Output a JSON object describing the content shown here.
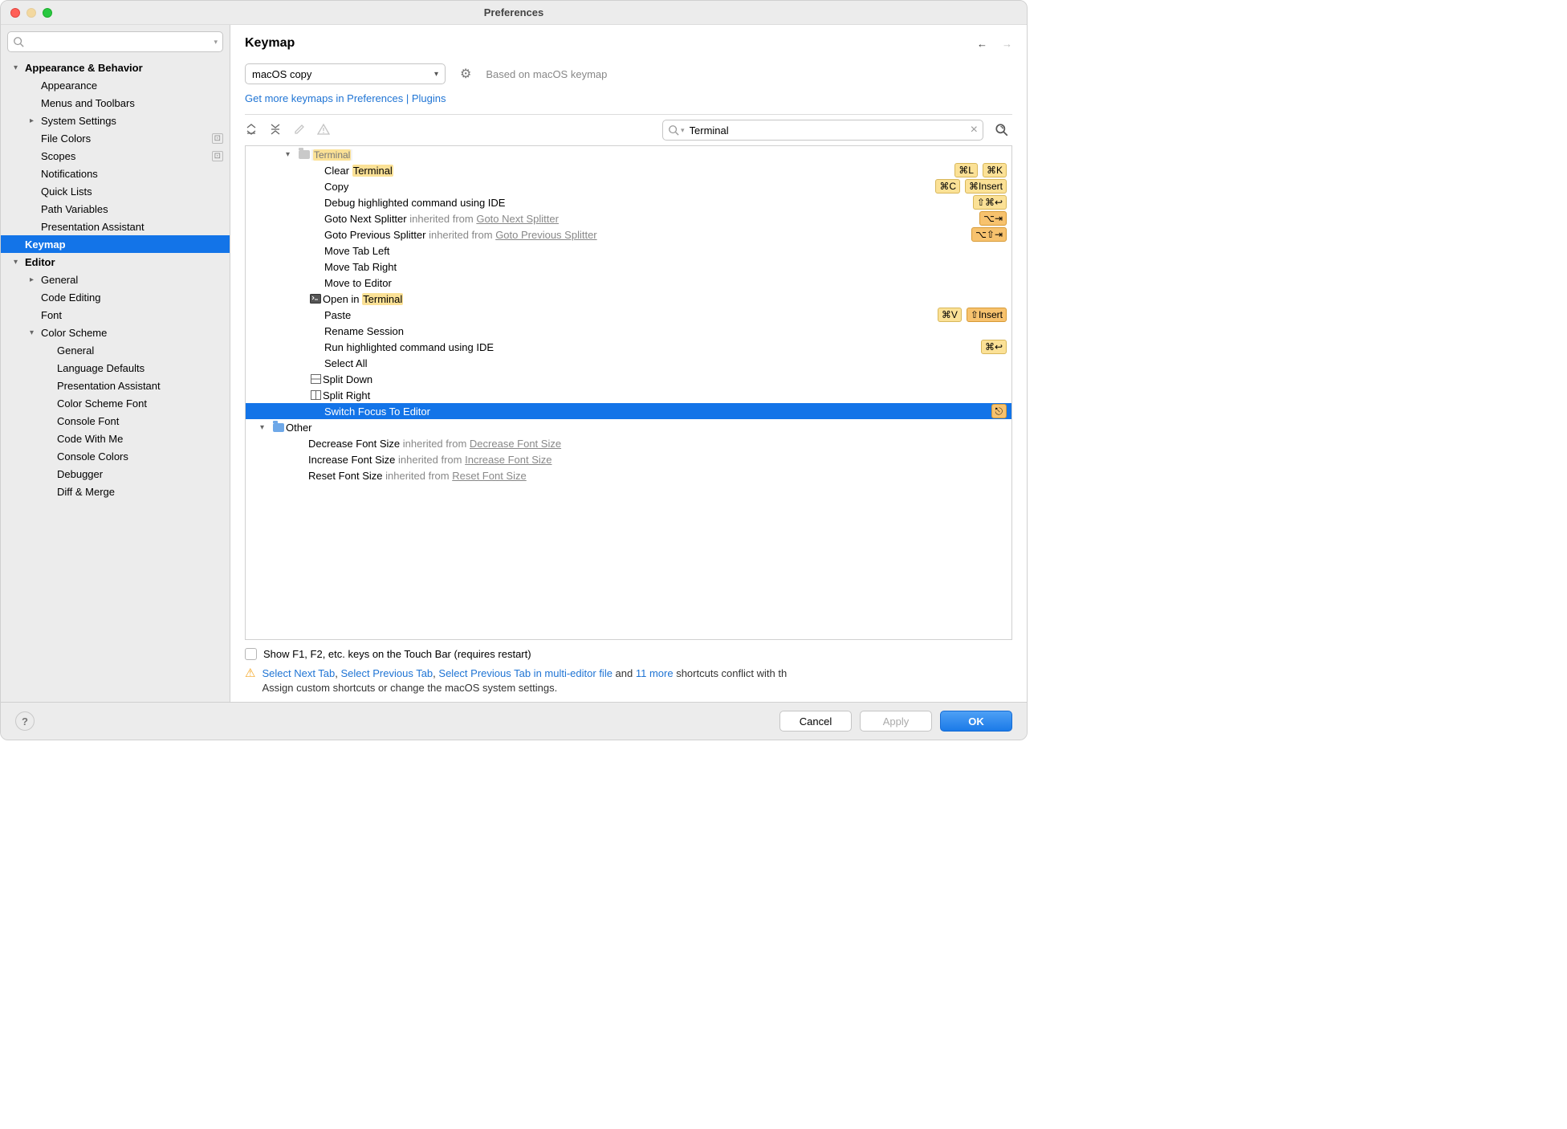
{
  "window": {
    "title": "Preferences"
  },
  "sidebar": {
    "search_placeholder": "",
    "items": [
      {
        "label": "Appearance & Behavior",
        "level": 0,
        "bold": true,
        "arrow": "down"
      },
      {
        "label": "Appearance",
        "level": 1
      },
      {
        "label": "Menus and Toolbars",
        "level": 1
      },
      {
        "label": "System Settings",
        "level": 1,
        "arrow": "right"
      },
      {
        "label": "File Colors",
        "level": 1,
        "badge": "⊡"
      },
      {
        "label": "Scopes",
        "level": 1,
        "badge": "⊡"
      },
      {
        "label": "Notifications",
        "level": 1
      },
      {
        "label": "Quick Lists",
        "level": 1
      },
      {
        "label": "Path Variables",
        "level": 1
      },
      {
        "label": "Presentation Assistant",
        "level": 1
      },
      {
        "label": "Keymap",
        "level": 0,
        "bold": true,
        "selected": true
      },
      {
        "label": "Editor",
        "level": 0,
        "bold": true,
        "arrow": "down"
      },
      {
        "label": "General",
        "level": 1,
        "arrow": "right"
      },
      {
        "label": "Code Editing",
        "level": 1
      },
      {
        "label": "Font",
        "level": 1
      },
      {
        "label": "Color Scheme",
        "level": 1,
        "arrow": "down"
      },
      {
        "label": "General",
        "level": 2
      },
      {
        "label": "Language Defaults",
        "level": 2
      },
      {
        "label": "Presentation Assistant",
        "level": 2
      },
      {
        "label": "Color Scheme Font",
        "level": 2
      },
      {
        "label": "Console Font",
        "level": 2
      },
      {
        "label": "Code With Me",
        "level": 2
      },
      {
        "label": "Console Colors",
        "level": 2
      },
      {
        "label": "Debugger",
        "level": 2
      },
      {
        "label": "Diff & Merge",
        "level": 2
      }
    ]
  },
  "main": {
    "title": "Keymap",
    "scheme": "macOS copy",
    "based_on": "Based on macOS keymap",
    "get_more_link": "Get more keymaps in Preferences | Plugins",
    "search_value": "Terminal",
    "terminal_group": "Terminal",
    "other_group": "Other",
    "actions": {
      "clear": {
        "pre": "Clear ",
        "hl": "Terminal",
        "sc": [
          "⌘L",
          "⌘K"
        ]
      },
      "copy": {
        "text": "Copy",
        "sc": [
          "⌘C",
          "⌘Insert"
        ]
      },
      "debug": {
        "text": "Debug highlighted command using IDE",
        "sc": [
          "⇧⌘↩"
        ]
      },
      "gonext": {
        "text": "Goto Next Splitter",
        "inh": "inherited from",
        "inh_link": "Goto Next Splitter",
        "sc": [
          "⌥⇥"
        ],
        "sc_orange": true
      },
      "goprev": {
        "text": "Goto Previous Splitter",
        "inh": "inherited from",
        "inh_link": "Goto Previous Splitter",
        "sc": [
          "⌥⇧⇥"
        ],
        "sc_orange": true
      },
      "mleft": {
        "text": "Move Tab Left"
      },
      "mright": {
        "text": "Move Tab Right"
      },
      "moveed": {
        "text": "Move to Editor"
      },
      "openin": {
        "pre": "Open in ",
        "hl": "Terminal",
        "icon": "terminal"
      },
      "paste": {
        "text": "Paste",
        "sc": [
          "⌘V",
          "⇧Insert"
        ],
        "sc_mixed": true
      },
      "rename": {
        "text": "Rename Session"
      },
      "run": {
        "text": "Run highlighted command using IDE",
        "sc": [
          "⌘↩"
        ]
      },
      "selall": {
        "text": "Select All"
      },
      "splitd": {
        "text": "Split Down",
        "icon": "splitdown"
      },
      "splitr": {
        "text": "Split Right",
        "icon": "splitright"
      },
      "switch": {
        "text": "Switch Focus To Editor",
        "selected": true,
        "sc": [
          "⎋"
        ],
        "sc_orange": true
      },
      "decfont": {
        "text": "Decrease Font Size",
        "inh": "inherited from",
        "inh_link": "Decrease Font Size"
      },
      "incfont": {
        "text": "Increase Font Size",
        "inh": "inherited from",
        "inh_link": "Increase Font Size"
      },
      "resfont": {
        "text": "Reset Font Size",
        "inh": "inherited from",
        "inh_link": "Reset Font Size"
      }
    },
    "touchbar_checkbox": "Show F1, F2, etc. keys on the Touch Bar (requires restart)",
    "conflicts": {
      "links": [
        "Select Next Tab",
        "Select Previous Tab",
        "Select Previous Tab in multi-editor file",
        "11 more"
      ],
      "mid_and": " and ",
      "tail": " shortcuts conflict with th",
      "line2": "Assign custom shortcuts or change the macOS system settings."
    }
  },
  "buttons": {
    "cancel": "Cancel",
    "apply": "Apply",
    "ok": "OK"
  }
}
